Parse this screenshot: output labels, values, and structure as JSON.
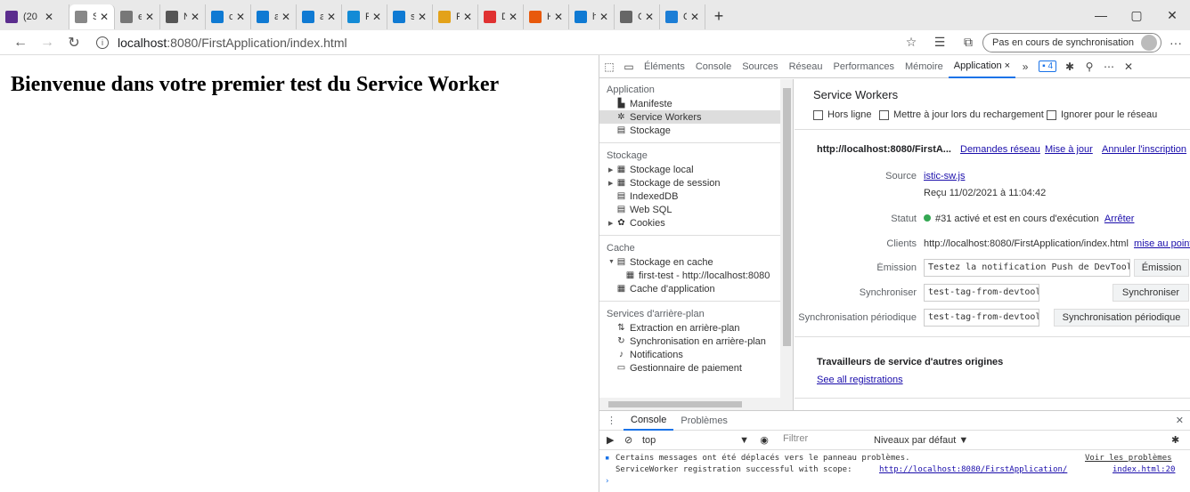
{
  "tabs": [
    {
      "label": "(20",
      "icon": "mail-icon",
      "color": "#5b2d8e"
    },
    {
      "label": "Serv",
      "icon": "worker-icon",
      "color": "#888888",
      "active": true
    },
    {
      "label": "edg",
      "icon": "document-icon",
      "color": "#777777"
    },
    {
      "label": "Nou",
      "icon": "newtab-icon",
      "color": "#555555"
    },
    {
      "label": "cod",
      "icon": "bing-icon",
      "color": "#0f7ad3"
    },
    {
      "label": "affic",
      "icon": "bing-icon",
      "color": "#0f7ad3"
    },
    {
      "label": "affic",
      "icon": "bing-icon",
      "color": "#0f7ad3"
    },
    {
      "label": "PW/",
      "icon": "site-icon",
      "color": "#138bd6"
    },
    {
      "label": "serv",
      "icon": "bing-icon",
      "color": "#0f7ad3"
    },
    {
      "label": "PW/",
      "icon": "pwa-icon",
      "color": "#e3a21a"
    },
    {
      "label": "Déc",
      "icon": "a-icon",
      "color": "#e03131"
    },
    {
      "label": "HTN",
      "icon": "html-icon",
      "color": "#e8590c"
    },
    {
      "label": "héb",
      "icon": "bing-icon",
      "color": "#0f7ad3"
    },
    {
      "label": "Crée",
      "icon": "face-icon",
      "color": "#666666"
    },
    {
      "label": "Qu'",
      "icon": "globe-icon",
      "color": "#1c7ed6"
    }
  ],
  "address": {
    "host": "localhost",
    "path": ":8080/FirstApplication/index.html",
    "sync_label": "Pas en cours de synchronisation"
  },
  "page": {
    "title": "Bienvenue dans votre premier test du Service Worker"
  },
  "devtools": {
    "tabs": [
      "Éléments",
      "Console",
      "Sources",
      "Réseau",
      "Performances",
      "Mémoire",
      "Application"
    ],
    "issues_count": "4",
    "sidebar": {
      "application_head": "Application",
      "application_items": [
        "Manifeste",
        "Service Workers",
        "Stockage"
      ],
      "storage_head": "Stockage",
      "storage_items": [
        "Stockage local",
        "Stockage de session",
        "IndexedDB",
        "Web SQL",
        "Cookies"
      ],
      "cache_head": "Cache",
      "cache_items": [
        "Stockage en cache",
        "first-test - http://localhost:8080",
        "Cache d'application"
      ],
      "bg_head": "Services d'arrière-plan",
      "bg_items": [
        "Extraction en arrière-plan",
        "Synchronisation en arrière-plan",
        "Notifications",
        "Gestionnaire de paiement"
      ]
    },
    "sw": {
      "title": "Service Workers",
      "opt_offline": "Hors ligne",
      "opt_update": "Mettre à jour lors du rechargement",
      "opt_bypass": "Ignorer pour le réseau",
      "origin": "http://localhost:8080/FirstA...",
      "link_requests": "Demandes réseau",
      "link_update": "Mise à jour",
      "link_unregister": "Annuler l'inscription",
      "source_label": "Source",
      "source_value": "istic-sw.js",
      "received": "Reçu 11/02/2021 à 11:04:42",
      "status_label": "Statut",
      "status_value": "#31 activé et est en cours d'exécution",
      "stop_link": "Arrêter",
      "clients_label": "Clients",
      "clients_value": "http://localhost:8080/FirstApplication/index.html",
      "focus_link": "mise au point",
      "push_label": "Émission",
      "push_value": "Testez la notification Push de DevTools.",
      "push_button": "Émission",
      "sync_label": "Synchroniser",
      "sync_value": "test-tag-from-devtools",
      "sync_button": "Synchroniser",
      "periodic_label": "Synchronisation périodique",
      "periodic_value": "test-tag-from-devtools",
      "periodic_button": "Synchronisation périodique",
      "other_title": "Travailleurs de service d'autres origines",
      "see_all": "See all registrations"
    },
    "drawer": {
      "tab_console": "Console",
      "tab_problems": "Problèmes",
      "context": "top",
      "filter_placeholder": "Filtrer",
      "levels": "Niveaux par défaut ▼",
      "msg1": "Certains messages ont été déplacés vers le panneau problèmes.",
      "msg1_link": "Voir les problèmes",
      "msg2_text": "ServiceWorker registration successful with scope: ",
      "msg2_link": "http://localhost:8080/FirstApplication/",
      "msg2_source": "index.html:20"
    }
  }
}
